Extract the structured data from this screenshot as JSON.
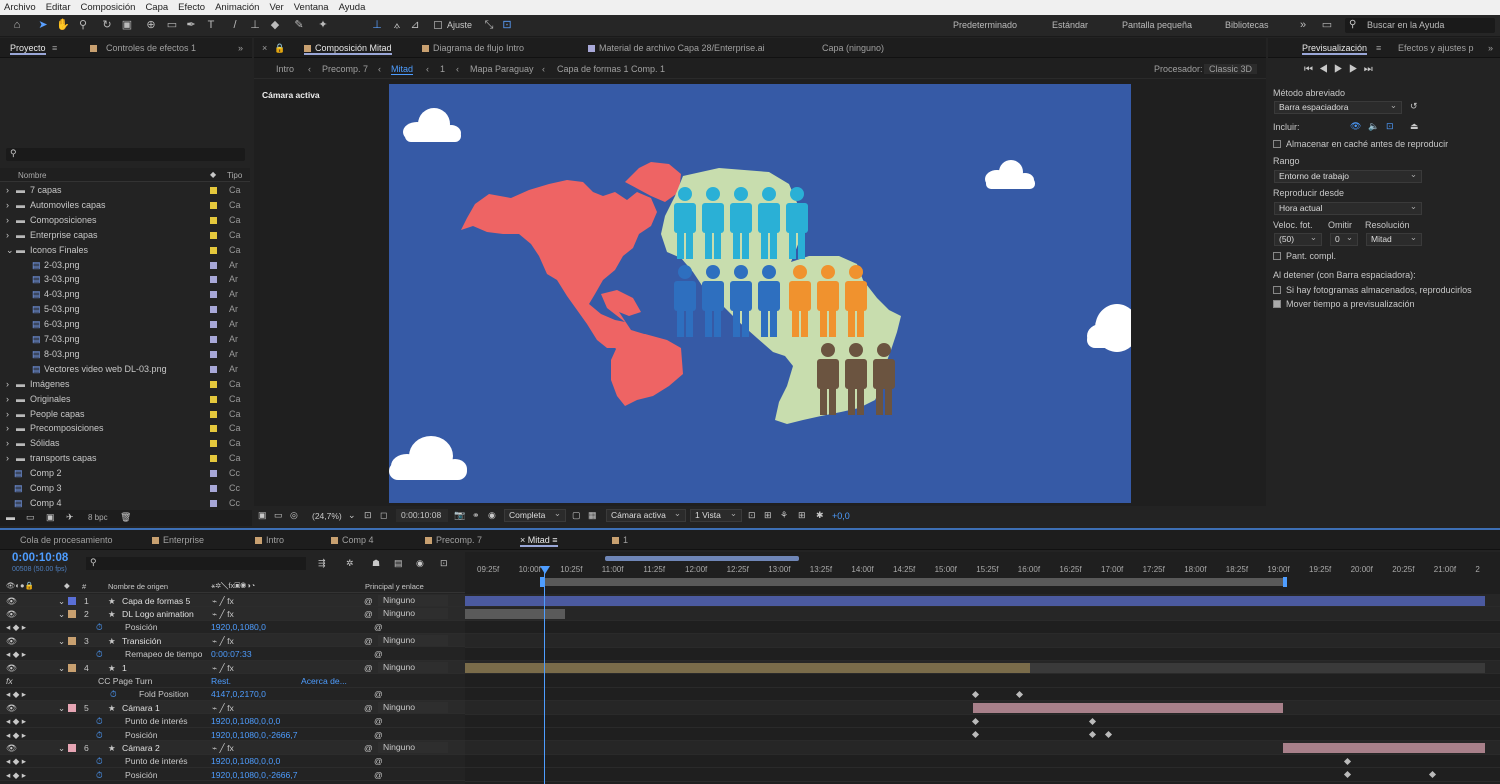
{
  "menu": [
    "Archivo",
    "Editar",
    "Composición",
    "Capa",
    "Efecto",
    "Animación",
    "Ver",
    "Ventana",
    "Ayuda"
  ],
  "toolbar": {
    "ajuste": "Ajuste",
    "workspaces": [
      "Predeterminado",
      "Estándar",
      "Pantalla pequeña",
      "Bibliotecas"
    ],
    "search_placeholder": "Buscar en la Ayuda"
  },
  "project": {
    "tab": "Proyecto",
    "tab2": "Controles de efectos 1",
    "col_name": "Nombre",
    "col_type": "Tipo",
    "bpc": "8 bpc",
    "items": [
      {
        "name": "7 capas",
        "type": "Ca",
        "color": "#e5c83c",
        "indent": 0,
        "folder": true
      },
      {
        "name": "Automoviles capas",
        "type": "Ca",
        "color": "#e5c83c",
        "indent": 0,
        "folder": true
      },
      {
        "name": "Comoposiciones",
        "type": "Ca",
        "color": "#e5c83c",
        "indent": 0,
        "folder": true
      },
      {
        "name": "Enterprise capas",
        "type": "Ca",
        "color": "#e5c83c",
        "indent": 0,
        "folder": true
      },
      {
        "name": "Iconos Finales",
        "type": "Ca",
        "color": "#e5c83c",
        "indent": 0,
        "folder": true,
        "open": true
      },
      {
        "name": "2-03.png",
        "type": "Ar",
        "color": "#a8a8d8",
        "indent": 1
      },
      {
        "name": "3-03.png",
        "type": "Ar",
        "color": "#a8a8d8",
        "indent": 1
      },
      {
        "name": "4-03.png",
        "type": "Ar",
        "color": "#a8a8d8",
        "indent": 1
      },
      {
        "name": "5-03.png",
        "type": "Ar",
        "color": "#a8a8d8",
        "indent": 1
      },
      {
        "name": "6-03.png",
        "type": "Ar",
        "color": "#a8a8d8",
        "indent": 1
      },
      {
        "name": "7-03.png",
        "type": "Ar",
        "color": "#a8a8d8",
        "indent": 1
      },
      {
        "name": "8-03.png",
        "type": "Ar",
        "color": "#a8a8d8",
        "indent": 1
      },
      {
        "name": "Vectores video web DL-03.png",
        "type": "Ar",
        "color": "#a8a8d8",
        "indent": 1
      },
      {
        "name": "Imágenes",
        "type": "Ca",
        "color": "#e5c83c",
        "indent": 0,
        "folder": true
      },
      {
        "name": "Originales",
        "type": "Ca",
        "color": "#e5c83c",
        "indent": 0,
        "folder": true
      },
      {
        "name": "People capas",
        "type": "Ca",
        "color": "#e5c83c",
        "indent": 0,
        "folder": true
      },
      {
        "name": "Precomposiciones",
        "type": "Ca",
        "color": "#e5c83c",
        "indent": 0,
        "folder": true
      },
      {
        "name": "Sólidas",
        "type": "Ca",
        "color": "#e5c83c",
        "indent": 0,
        "folder": true
      },
      {
        "name": "transports capas",
        "type": "Ca",
        "color": "#e5c83c",
        "indent": 0,
        "folder": true
      },
      {
        "name": "Comp 2",
        "type": "Cc",
        "color": "#a8a8d8",
        "indent": 0
      },
      {
        "name": "Comp 3",
        "type": "Cc",
        "color": "#a8a8d8",
        "indent": 0
      },
      {
        "name": "Comp 4",
        "type": "Cc",
        "color": "#a8a8d8",
        "indent": 0
      }
    ]
  },
  "viewer": {
    "tabs": [
      "Composición Mitad",
      "Diagrama de flujo Intro",
      "Material de archivo Capa 28/Enterprise.ai",
      "Capa (ninguno)"
    ],
    "breadcrumbs": [
      "Intro",
      "Precomp. 7",
      "Mitad",
      "1",
      "Mapa Paraguay",
      "Capa de formas 1 Comp. 1"
    ],
    "procesador_label": "Procesador:",
    "procesador": "Classic 3D",
    "camera_label": "Cámara activa",
    "zoom": "(24,7%)",
    "time": "0:00:10:08",
    "resolution": "Completa",
    "camera": "Cámara activa",
    "views": "1 Vista",
    "exposure": "+0,0"
  },
  "preview": {
    "tab": "Previsualización",
    "tab2": "Efectos y ajustes p",
    "metodo_label": "Método abreviado",
    "metodo": "Barra espaciadora",
    "incluir": "Incluir:",
    "cache": "Almacenar en caché antes de reproducir",
    "rango_label": "Rango",
    "rango": "Entorno de trabajo",
    "desde_label": "Reproducir desde",
    "desde": "Hora actual",
    "fps_label": "Veloc. fot.",
    "omitir_label": "Omitir",
    "res_label": "Resolución",
    "fps": "(50)",
    "omitir": "0",
    "res": "Mitad",
    "pant": "Pant. compl.",
    "detener": "Al detener (con Barra espaciadora):",
    "opt1": "Si hay fotogramas almacenados, reproducirlos",
    "opt2": "Mover tiempo a previsualización"
  },
  "timeline": {
    "tabs": [
      "Cola de procesamiento",
      "Enterprise",
      "Intro",
      "Comp 4",
      "Precomp. 7",
      "Mitad",
      "1"
    ],
    "active_tab": "Mitad",
    "time": "0:00:10:08",
    "frames": "00508 (50.00 fps)",
    "col_source": "Nombre de origen",
    "col_parent": "Principal y enlace",
    "ruler": [
      "09:25f",
      "10:00f",
      "10:25f",
      "11:00f",
      "11:25f",
      "12:00f",
      "12:25f",
      "13:00f",
      "13:25f",
      "14:00f",
      "14:25f",
      "15:00f",
      "15:25f",
      "16:00f",
      "16:25f",
      "17:00f",
      "17:25f",
      "18:00f",
      "18:25f",
      "19:00f",
      "19:25f",
      "20:00f",
      "20:25f",
      "21:00f",
      "2"
    ],
    "layers": [
      {
        "num": "1",
        "name": "Capa de formas 5",
        "parent": "Ninguno",
        "color": "#5a6fd6",
        "kind": "layer"
      },
      {
        "num": "2",
        "name": "DL Logo animation",
        "parent": "Ninguno",
        "color": "#c8a070",
        "kind": "layer"
      },
      {
        "name": "Posición",
        "value": "1920,0,1080,0",
        "kind": "prop"
      },
      {
        "num": "3",
        "name": "Transición",
        "parent": "Ninguno",
        "color": "#c8a070",
        "kind": "layer"
      },
      {
        "name": "Remapeo de tiempo",
        "value": "0:00:07:33",
        "kind": "prop"
      },
      {
        "num": "4",
        "name": "1",
        "parent": "Ninguno",
        "color": "#c8a070",
        "kind": "layer"
      },
      {
        "name": "CC Page Turn",
        "value": "Rest.",
        "extra": "Acerca de...",
        "kind": "fx"
      },
      {
        "name": "Fold Position",
        "value": "4147,0,2170,0",
        "kind": "prop2"
      },
      {
        "num": "5",
        "name": "Cámara 1",
        "parent": "Ninguno",
        "color": "#e6a5b4",
        "kind": "layer"
      },
      {
        "name": "Punto de interés",
        "value": "1920,0,1080,0,0,0",
        "kind": "prop"
      },
      {
        "name": "Posición",
        "value": "1920,0,1080,0,-2666,7",
        "kind": "prop"
      },
      {
        "num": "6",
        "name": "Cámara 2",
        "parent": "Ninguno",
        "color": "#e6a5b4",
        "kind": "layer"
      },
      {
        "name": "Punto de interés",
        "value": "1920,0,1080,0,0,0",
        "kind": "prop"
      },
      {
        "name": "Posición",
        "value": "1920,0,1080,0,-2666,7",
        "kind": "prop"
      }
    ]
  }
}
